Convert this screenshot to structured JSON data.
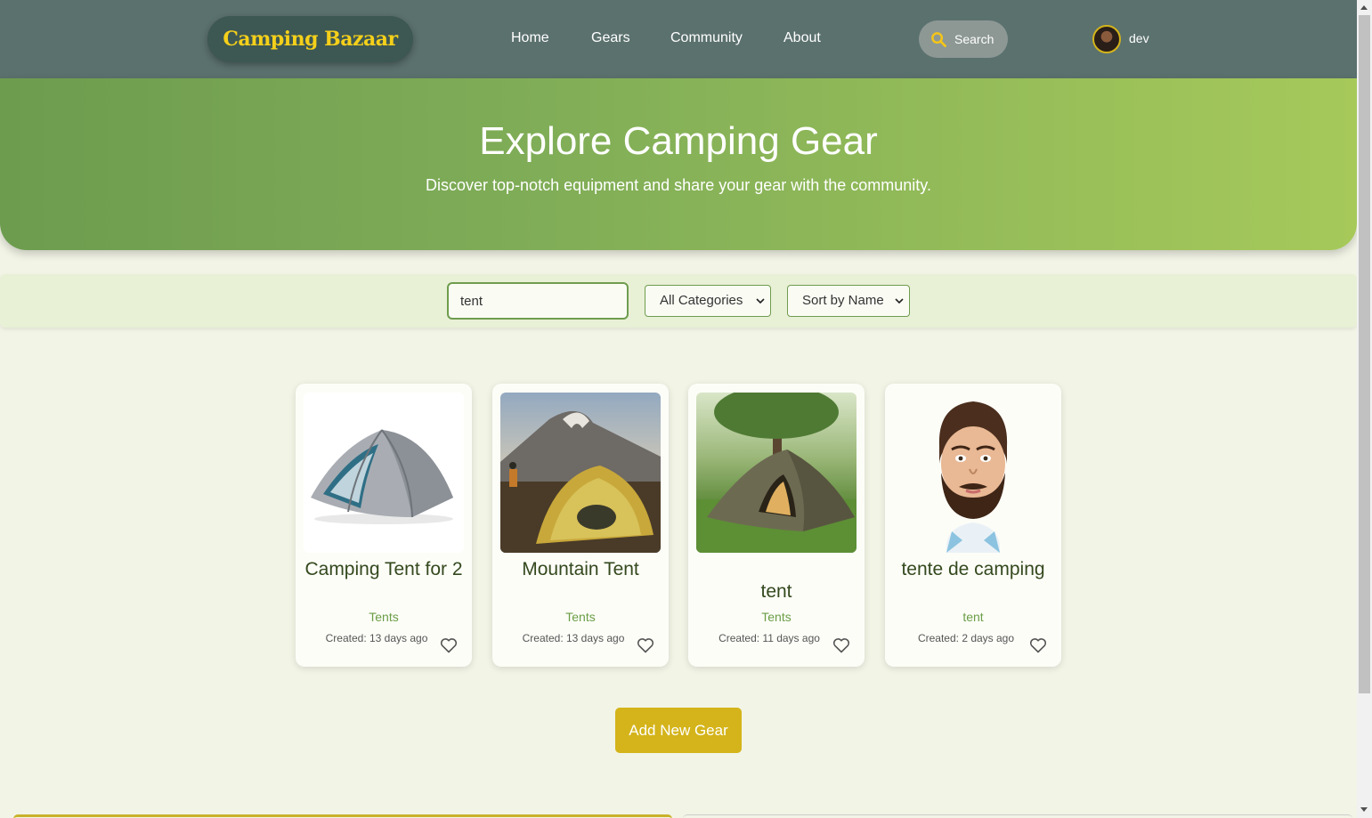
{
  "nav": {
    "logo": "Camping Bazaar",
    "links": [
      "Home",
      "Gears",
      "Community",
      "About"
    ],
    "search_label": "Search",
    "username": "dev"
  },
  "hero": {
    "title": "Explore Camping Gear",
    "subtitle": "Discover top-notch equipment and share your gear with the community."
  },
  "filters": {
    "search_value": "tent",
    "category": "All Categories",
    "sort": "Sort by Name"
  },
  "cards": [
    {
      "title": "Camping Tent for 2",
      "category": "Tents",
      "created": "Created: 13 days ago",
      "image": "grey-dome-tent"
    },
    {
      "title": "Mountain Tent",
      "category": "Tents",
      "created": "Created: 13 days ago",
      "image": "mountain-camp-tent"
    },
    {
      "title": "tent",
      "category": "Tents",
      "created": "Created: 11 days ago",
      "image": "green-field-tent"
    },
    {
      "title": "tente de camping",
      "category": "tent",
      "created": "Created: 2 days ago",
      "image": "bearded-man-caricature"
    }
  ],
  "add_button": "Add New Gear"
}
